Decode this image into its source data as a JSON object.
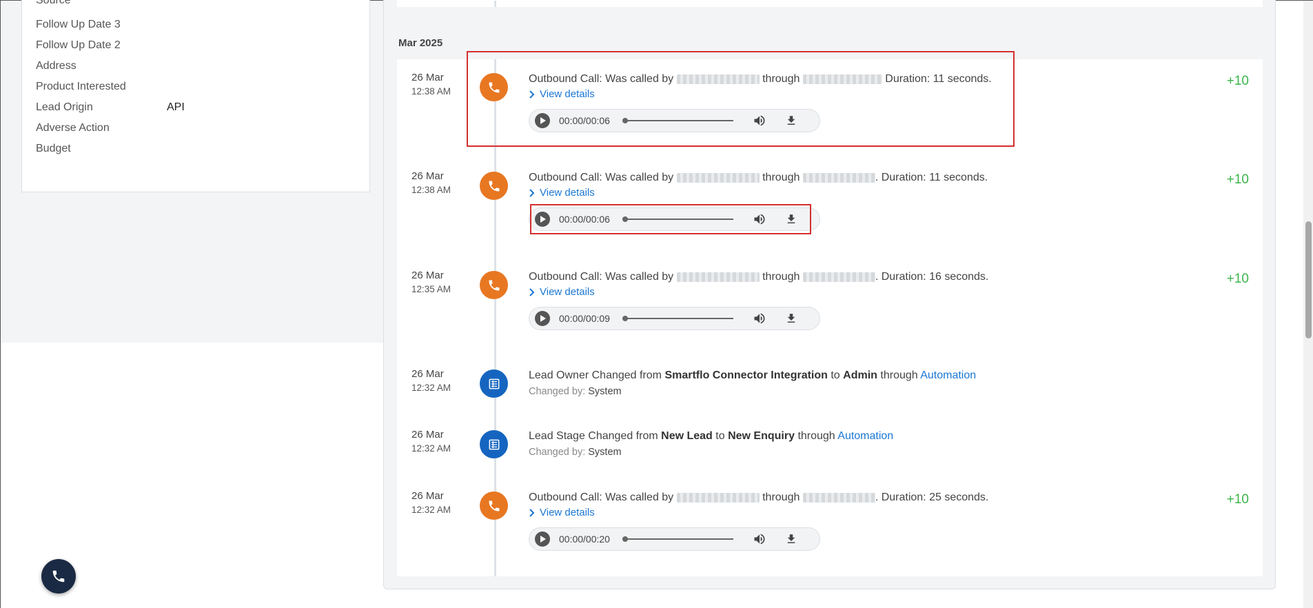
{
  "left_panel": {
    "fields": [
      {
        "label": "Source",
        "value": ""
      },
      {
        "label": "Follow Up Date 3",
        "value": ""
      },
      {
        "label": "Follow Up Date 2",
        "value": ""
      },
      {
        "label": "Address",
        "value": ""
      },
      {
        "label": "Product Interested",
        "value": ""
      },
      {
        "label": "Lead Origin",
        "value": "API"
      },
      {
        "label": "Adverse Action",
        "value": ""
      },
      {
        "label": "Budget",
        "value": ""
      }
    ]
  },
  "timeline": {
    "month": "Mar 2025",
    "entries": [
      {
        "type": "call",
        "date": "26 Mar",
        "time": "12:38 AM",
        "prefix": "Outbound Call: Was called by",
        "through": "through",
        "duration": "Duration: 11 seconds.",
        "view_details": "View details",
        "player_time": "00:00/00:06",
        "points": "+10"
      },
      {
        "type": "call",
        "date": "26 Mar",
        "time": "12:38 AM",
        "prefix": "Outbound Call: Was called by",
        "through": "through",
        "duration": ". Duration: 11 seconds.",
        "view_details": "View details",
        "player_time": "00:00/00:06",
        "points": "+10"
      },
      {
        "type": "call",
        "date": "26 Mar",
        "time": "12:35 AM",
        "prefix": "Outbound Call: Was called by",
        "through": "through",
        "duration": ". Duration: 16 seconds.",
        "view_details": "View details",
        "player_time": "00:00/00:09",
        "points": "+10"
      },
      {
        "type": "change",
        "date": "26 Mar",
        "time": "12:32 AM",
        "t1": "Lead Owner Changed from",
        "from": "Smartflo Connector Integration",
        "to_word": "to",
        "to": "Admin",
        "through": "through",
        "link": "Automation",
        "changed_by_label": "Changed by:",
        "changed_by": "System"
      },
      {
        "type": "change",
        "date": "26 Mar",
        "time": "12:32 AM",
        "t1": "Lead Stage Changed from",
        "from": "New Lead",
        "to_word": "to",
        "to": "New Enquiry",
        "through": "through",
        "link": "Automation",
        "changed_by_label": "Changed by:",
        "changed_by": "System"
      },
      {
        "type": "call",
        "date": "26 Mar",
        "time": "12:32 AM",
        "prefix": "Outbound Call: Was called by",
        "through": "through",
        "duration": ". Duration: 25 seconds.",
        "view_details": "View details",
        "player_time": "00:00/00:20",
        "points": "+10"
      }
    ]
  },
  "colors": {
    "call_badge": "#e87722",
    "info_badge": "#1565c0",
    "points": "#3bb54a",
    "link": "#1976d2",
    "highlight": "#d32f2f"
  },
  "icons": {
    "call": "phone-icon",
    "info": "list-icon",
    "fab": "phone-icon"
  }
}
